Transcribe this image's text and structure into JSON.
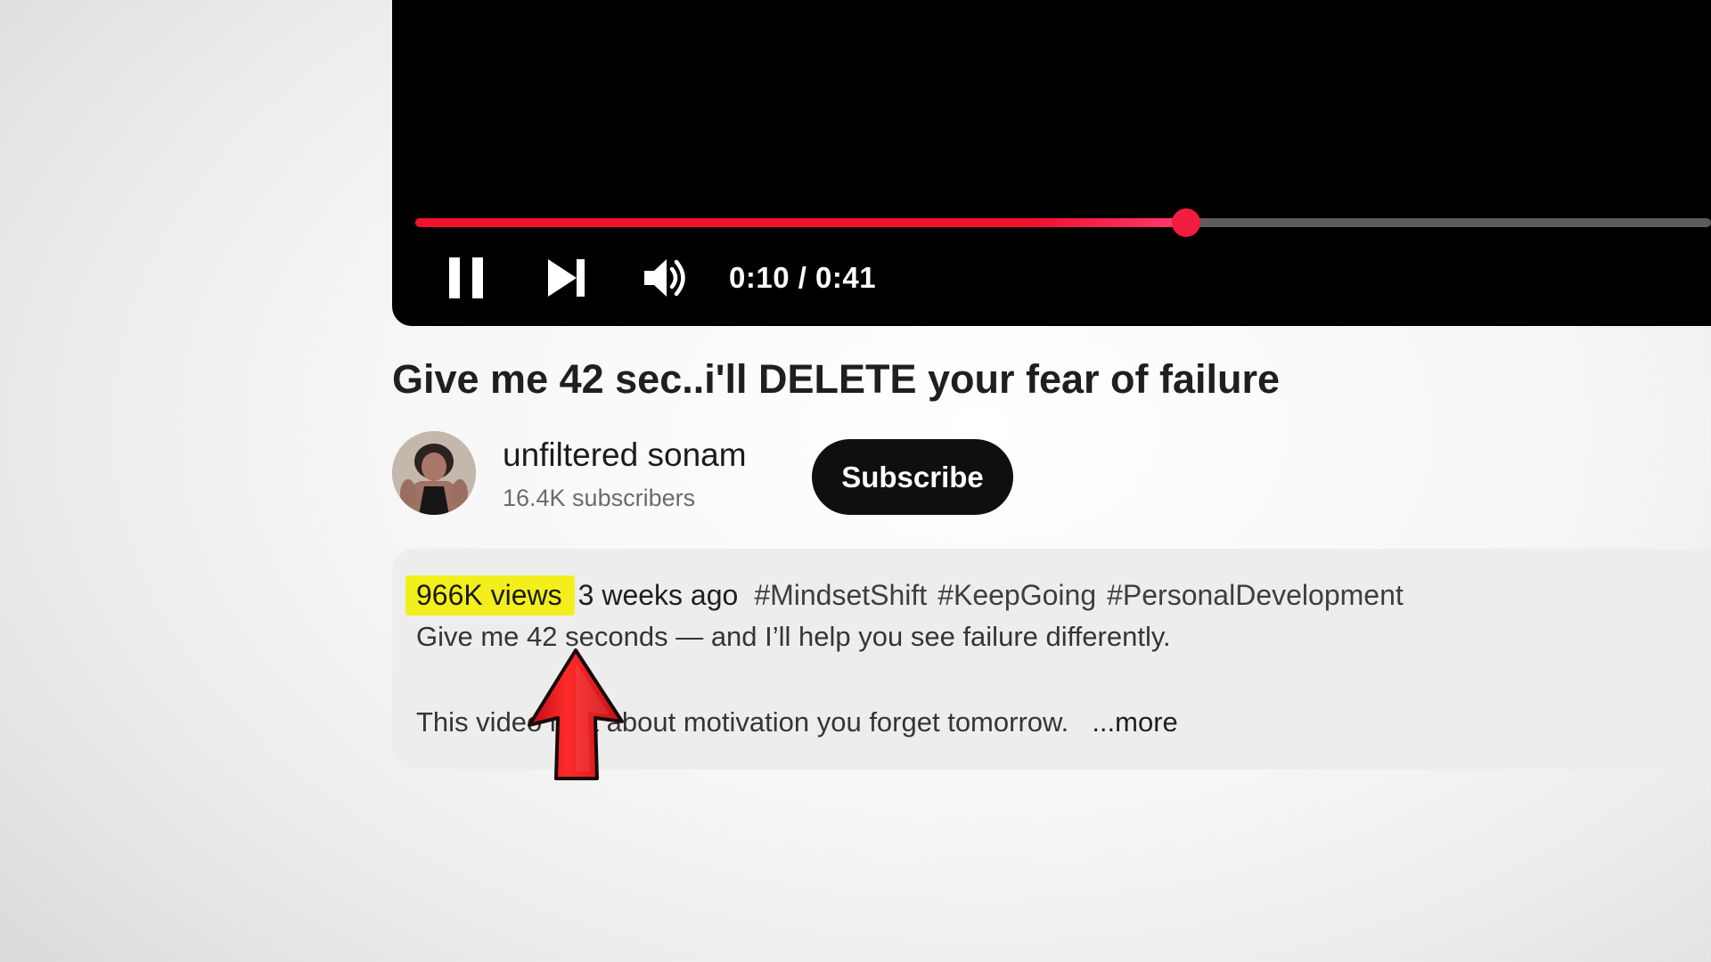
{
  "player": {
    "time_display": "0:10 / 0:41",
    "progress_fraction": 0.595,
    "accent_color": "#f1102d",
    "controls": {
      "pause_icon": "pause-icon",
      "next_icon": "skip-next-icon",
      "volume_icon": "volume-icon"
    }
  },
  "video": {
    "title": "Give me 42 sec..i'll DELETE your fear of failure"
  },
  "channel": {
    "name": "unfiltered sonam",
    "subscribers": "16.4K subscribers",
    "avatar_icon": "channel-avatar"
  },
  "subscribe": {
    "label": "Subscribe"
  },
  "description": {
    "views": "966K views",
    "age": "3 weeks ago",
    "hashtags": [
      "#MindsetShift",
      "#KeepGoing",
      "#PersonalDevelopment"
    ],
    "line1": "Give me 42 seconds — and I’ll help you see failure differently.",
    "line2": "This video isn’t about motivation you forget tomorrow.",
    "more_label": "...more",
    "highlight_color": "#f3ef1c"
  },
  "annotation": {
    "arrow_icon": "red-arrow-icon",
    "arrow_color": "#e8141c"
  }
}
